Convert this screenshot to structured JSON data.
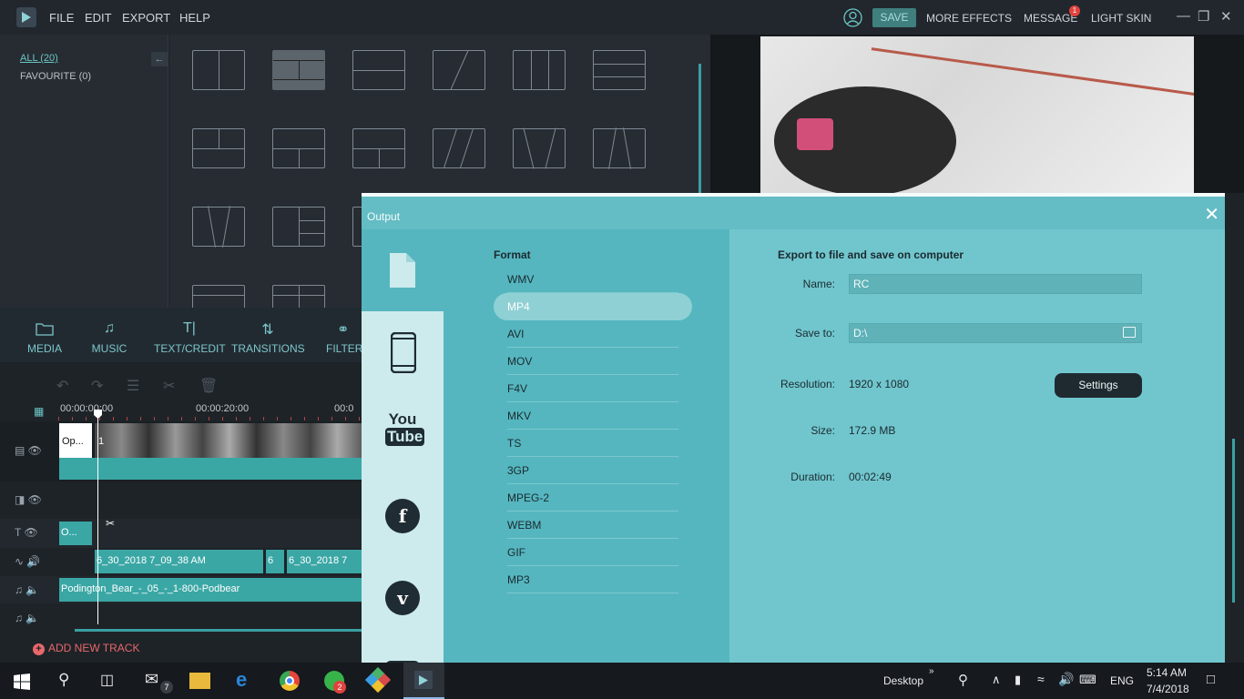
{
  "menubar": {
    "items": [
      "FILE",
      "EDIT",
      "EXPORT",
      "HELP"
    ],
    "save": "SAVE",
    "more_effects": "MORE EFFECTS",
    "message": "MESSAGE",
    "message_badge": "1",
    "light_skin": "LIGHT SKIN"
  },
  "categories": {
    "all": "ALL (20)",
    "favourite": "FAVOURITE (0)"
  },
  "tooltabs": {
    "media": "MEDIA",
    "music": "MUSIC",
    "textcredit": "TEXT/CREDIT",
    "transitions": "TRANSITIONS",
    "filters": "FILTER"
  },
  "timeline": {
    "ruler": [
      "00:00:00:00",
      "00:00:20:00",
      "00:0"
    ],
    "video_clip_label": "Op...",
    "video_clip_num": "1",
    "text_clip": "O...",
    "audio_clip_1": "6_30_2018 7_09_38 AM",
    "audio_clip_2": "6",
    "audio_clip_3": "6_30_2018 7",
    "music_clip": "Podington_Bear_-_05_-_1-800-Podbear",
    "add_track": "ADD NEW TRACK"
  },
  "dialog": {
    "title": "Output",
    "format_label": "Format",
    "formats": [
      "WMV",
      "MP4",
      "AVI",
      "MOV",
      "F4V",
      "MKV",
      "TS",
      "3GP",
      "MPEG-2",
      "WEBM",
      "GIF",
      "MP3"
    ],
    "selected_format": "MP4",
    "side_items": [
      "device",
      "phone",
      "youtube",
      "facebook",
      "vimeo"
    ],
    "youtube_top": "You",
    "youtube_bottom": "Tube",
    "facebook": "f",
    "vimeo": "v",
    "export_title": "Export to file and save on computer",
    "name_label": "Name:",
    "name_value": "RC",
    "save_to_label": "Save to:",
    "save_to_value": "D:\\",
    "resolution_label": "Resolution:",
    "resolution_value": "1920 x 1080",
    "settings_button": "Settings",
    "size_label": "Size:",
    "size_value": "172.9 MB",
    "duration_label": "Duration:",
    "duration_value": "00:02:49"
  },
  "taskbar": {
    "desktop": "Desktop",
    "lang": "ENG",
    "time": "5:14 AM",
    "date": "7/4/2018",
    "mail_badge": "7",
    "whatsapp_badge": "2"
  },
  "colors": {
    "accent": "#3aa7a5",
    "dialog_bg": "#55b6bf",
    "settings_bg": "#71c6cd"
  }
}
